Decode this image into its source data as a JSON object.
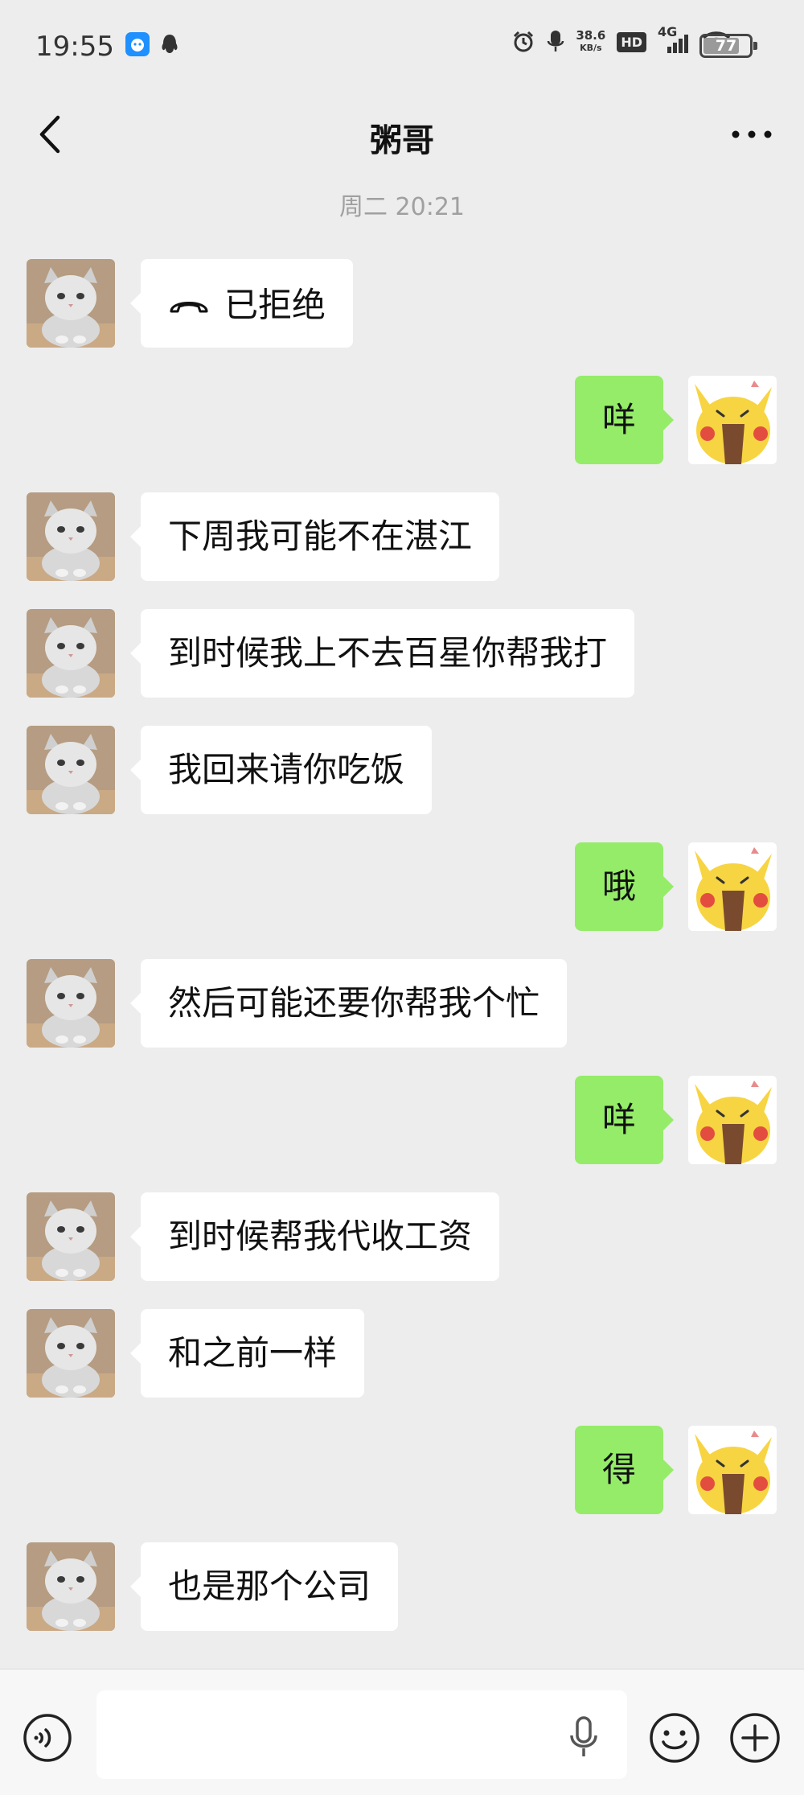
{
  "status_bar": {
    "time": "19:55",
    "net_speed_value": "38.6",
    "net_speed_unit": "KB/s",
    "hd": "HD",
    "network": "4G",
    "battery": "77"
  },
  "header": {
    "title": "粥哥"
  },
  "timestamp": "周二 20:21",
  "messages": [
    {
      "side": "in",
      "text": "已拒绝",
      "call": true
    },
    {
      "side": "out",
      "text": "咩"
    },
    {
      "side": "in",
      "text": "下周我可能不在湛江"
    },
    {
      "side": "in",
      "text": "到时候我上不去百星你帮我打"
    },
    {
      "side": "in",
      "text": "我回来请你吃饭"
    },
    {
      "side": "out",
      "text": "哦"
    },
    {
      "side": "in",
      "text": "然后可能还要你帮我个忙"
    },
    {
      "side": "out",
      "text": "咩"
    },
    {
      "side": "in",
      "text": "到时候帮我代收工资"
    },
    {
      "side": "in",
      "text": "和之前一样"
    },
    {
      "side": "out",
      "text": "得"
    },
    {
      "side": "in",
      "text": "也是那个公司"
    }
  ],
  "colors": {
    "background": "#ededed",
    "outgoing_bubble": "#95ec69",
    "incoming_bubble": "#ffffff"
  },
  "input_bar": {
    "value": ""
  }
}
